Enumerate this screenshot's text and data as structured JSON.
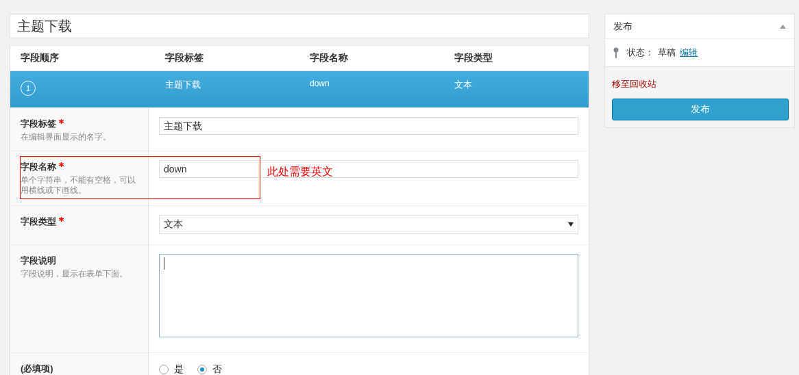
{
  "title_field": {
    "value": "主题下载"
  },
  "fields_table": {
    "columns": [
      "字段顺序",
      "字段标签",
      "字段名称",
      "字段类型"
    ],
    "rows": [
      {
        "order": "1",
        "label": "主题下载",
        "name": "down",
        "type": "文本",
        "selected": true
      }
    ]
  },
  "form": {
    "rows": [
      {
        "kind": "text",
        "label": "字段标签",
        "required": true,
        "hint": "在编辑界面显示的名字。",
        "value": "主题下载"
      },
      {
        "kind": "text",
        "label": "字段名称",
        "required": true,
        "hint": "单个字符串，不能有空格，可以用横线或下画线。",
        "value": "down"
      },
      {
        "kind": "select",
        "label": "字段类型",
        "required": true,
        "value": "文本"
      },
      {
        "kind": "textarea",
        "label": "字段说明",
        "required": false,
        "hint": "字段说明，显示在表单下面。"
      },
      {
        "kind": "radio",
        "label": "(必填项)",
        "required": false,
        "options": [
          {
            "label": "是",
            "selected": false
          },
          {
            "label": "否",
            "selected": true
          }
        ]
      }
    ]
  },
  "annotation": {
    "text": "此处需要英文"
  },
  "publish_box": {
    "title": "发布",
    "status_label": "状态：",
    "status_value": "草稿",
    "edit_link": "编辑",
    "trash_link": "移至回收站",
    "publish_button": "发布"
  }
}
